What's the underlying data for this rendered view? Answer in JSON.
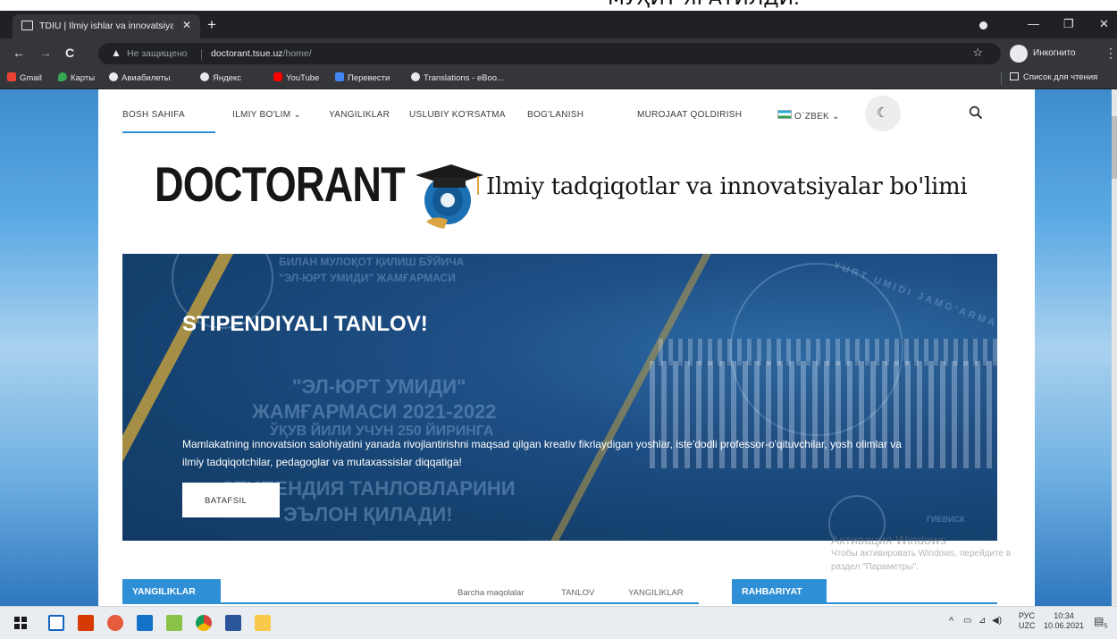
{
  "caption_fragment": "МУҲИТ ЯРАТИЛДИ.",
  "browser": {
    "tab_title": "TDIU | Ilmiy ishlar va innovatsiyal",
    "not_secure": "Не защищено",
    "url_domain": "doctorant.tsue.uz",
    "url_path": "/home/",
    "incognito_label": "Инкогнито",
    "reading_list": "Список для чтения",
    "bookmarks": [
      "Gmail",
      "Карты",
      "Авиабилеты",
      "Яндекс",
      "YouTube",
      "Перевести",
      "Translations - eBoo..."
    ]
  },
  "site": {
    "nav": {
      "home": "BOSH SAHIFA",
      "science": "ILMIY BO'LIM",
      "news": "YANGILIKLAR",
      "guide": "USLUBIY KO'RSATMA",
      "contact": "BOG'LANISH",
      "appeal": "MUROJAAT QOLDIRISH",
      "language": "O`ZBEK"
    },
    "brand": "DOCTORANT",
    "tagline": "Ilmiy tadqiqotlar va innovatsiyalar bo'limi",
    "hero": {
      "title": "STIPENDIYALI TANLOV!",
      "text": "Mamlakatning innovatsion salohiyatini yanada rivojlantirishni maqsad qilgan kreativ fikrlaydigan yoshlar, iste'dodli professor-o'qituvchilar, yosh olimlar va ilmiy tadqiqotchilar, pedagoglar va mutaxassislar diqqatiga!",
      "button": "BATAFSIL",
      "bg_line1": "БИЛАН МУЛОҚОТ ҚИЛИШ БЎЙИЧА",
      "bg_line2": "\"ЭЛ-ЮРТ УМИДИ\" ЖАМҒАРМАСИ",
      "bg_line3": "\"ЭЛ-ЮРТ УМИДИ\"",
      "bg_line4": "ЖАМҒАРМАСИ 2021-2022",
      "bg_line5": "ЎҚУВ ЙИЛИ УЧУН 250 ЙИРИНГА",
      "bg_line6": "СТИПЕНДИЯ ТАНЛОВЛАРИНИ",
      "bg_line7": "ЭЪЛОН ҚИЛАДИ!",
      "seal_text": "YURT UMIDI JAMG'ARMA",
      "podium_text": "ГИЕВИСК"
    },
    "news_section": "YANGILIKLAR",
    "filters": [
      "Barcha maqolalar",
      "TANLOV",
      "YANGILIKLAR"
    ],
    "leaders_section": "RAHBARIYAT"
  },
  "windows_watermark": {
    "line1": "Активация Windows",
    "line2": "Чтобы активировать Windows, перейдите в",
    "line3": "раздел \"Параметры\"."
  },
  "taskbar": {
    "lang": "РУС",
    "lang2": "UZC",
    "time": "10:34",
    "date": "10.06.2021",
    "notif_count": "5"
  },
  "colors": {
    "accent": "#2f8fd6",
    "hero_bg": "#1e4f86",
    "chrome_dark": "#202124"
  }
}
